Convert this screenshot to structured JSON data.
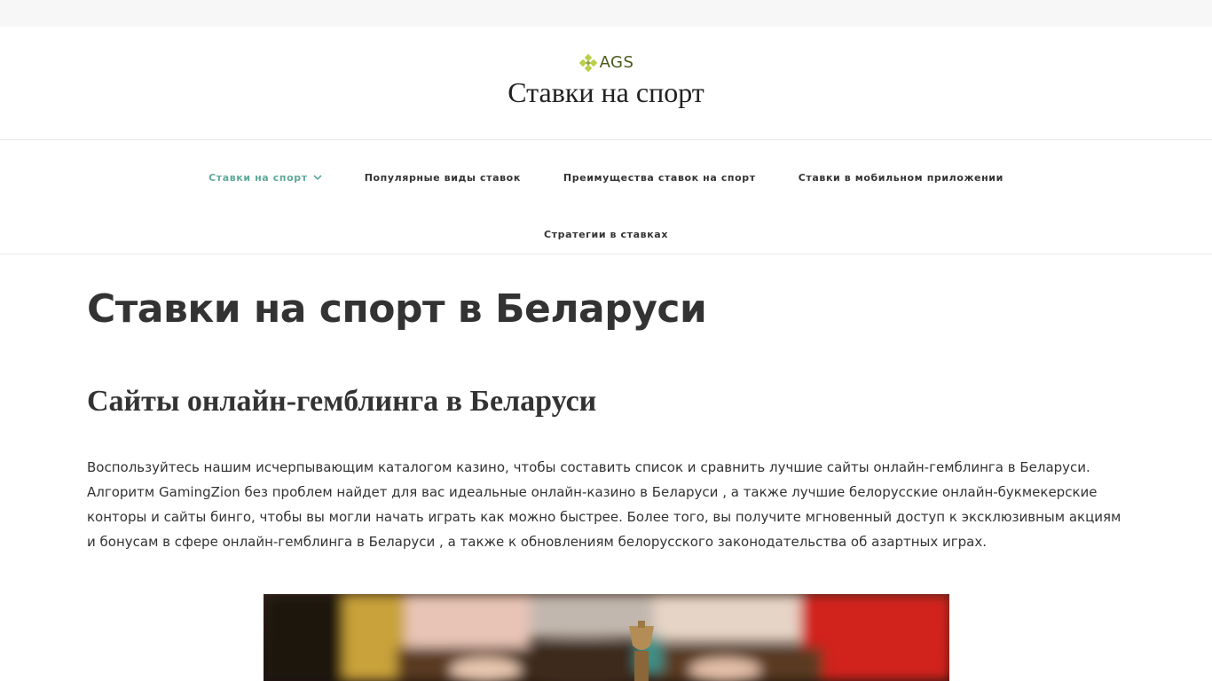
{
  "logo": {
    "text": "AGS",
    "icon": "ornament-diamond-icon"
  },
  "site": {
    "title": "Ставки на спорт"
  },
  "nav": {
    "items": [
      {
        "label": "Ставки на спорт",
        "active": true,
        "icon": "chevron-down-icon"
      },
      {
        "label": "Популярные виды ставок"
      },
      {
        "label": "Преимущества ставок на спорт"
      },
      {
        "label": "Ставки в мобильном приложении"
      },
      {
        "label": "Стратегии в ставках"
      }
    ]
  },
  "main": {
    "title": "Ставки на спорт в Беларуси",
    "section_title": "Сайты онлайн-гемблинга в Беларуси",
    "paragraph": "Воспользуйтесь нашим исчерпывающим каталогом казино, чтобы составить список и сравнить лучшие сайты онлайн-гемблинга в Беларуси. Алгоритм GamingZion без проблем найдет для вас идеальные онлайн-казино в Беларуси , а также лучшие белорусские онлайн-букмекерские конторы и сайты бинго, чтобы вы могли начать играть как можно быстрее. Более того, вы получите мгновенный доступ к эксклюзивным акциям и бонусам в сфере онлайн-гемблинга в Беларуси , а также к обновлениям белорусского законодательства об азартных играх."
  },
  "colors": {
    "accent": "#5fa89a",
    "text": "#333333",
    "topbar": "#f7f7f7",
    "logo": "#4a5a1c"
  }
}
